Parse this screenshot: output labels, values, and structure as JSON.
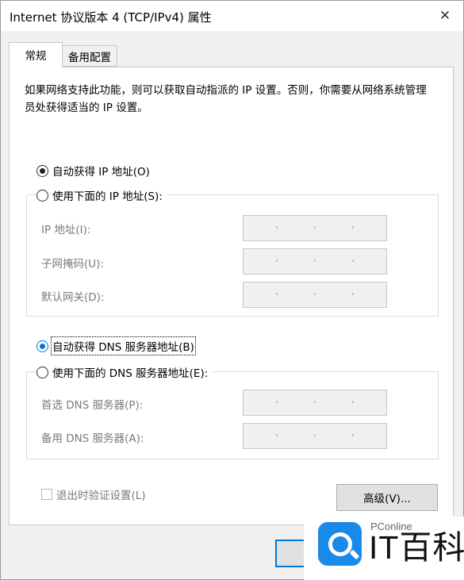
{
  "window": {
    "title": "Internet 协议版本 4 (TCP/IPv4) 属性",
    "close_glyph": "✕"
  },
  "tabs": [
    {
      "label": "常规",
      "active": true
    },
    {
      "label": "备用配置",
      "active": false
    }
  ],
  "general": {
    "intro": "如果网络支持此功能，则可以获取自动指派的 IP 设置。否则，你需要从网络系统管理员处获得适当的 IP 设置。",
    "ip": {
      "auto_label": "自动获得 IP 地址(O)",
      "manual_label": "使用下面的 IP 地址(S):",
      "selected": "auto",
      "fields": [
        {
          "label": "IP 地址(I):",
          "value": ". . ."
        },
        {
          "label": "子网掩码(U):",
          "value": ". . ."
        },
        {
          "label": "默认网关(D):",
          "value": ". . ."
        }
      ]
    },
    "dns": {
      "auto_label": "自动获得 DNS 服务器地址(B)",
      "manual_label": "使用下面的 DNS 服务器地址(E):",
      "selected": "auto",
      "fields": [
        {
          "label": "首选 DNS 服务器(P):",
          "value": ". . ."
        },
        {
          "label": "备用 DNS 服务器(A):",
          "value": ". . ."
        }
      ]
    },
    "validate_label": "退出时验证设置(L)",
    "validate_checked": false,
    "advanced_button": "高级(V)..."
  },
  "dot": "·",
  "watermark": {
    "small": "PConline",
    "big": "IT百科"
  },
  "colors": {
    "accent": "#0078d7",
    "watermark_blue": "#1a8ae8"
  }
}
